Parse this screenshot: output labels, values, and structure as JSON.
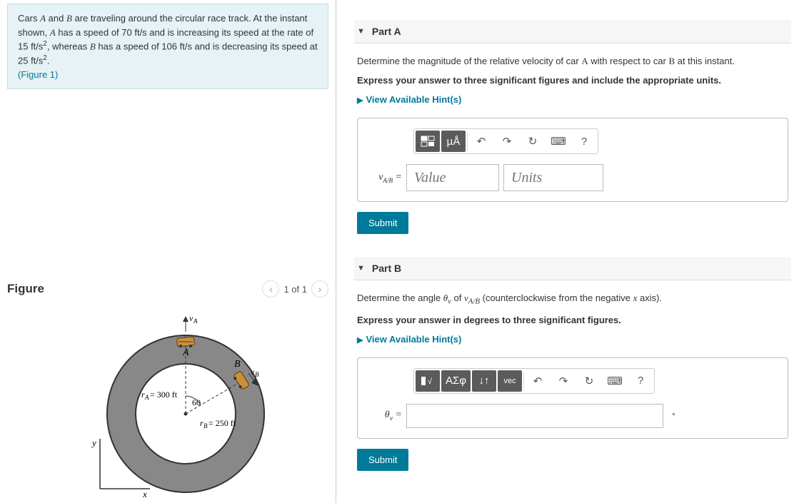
{
  "problem": {
    "text_parts": {
      "p1": "Cars ",
      "A": "A",
      "p2": " and ",
      "B": "B",
      "p3": " are traveling around the circular race track. At the instant shown, ",
      "p4": " has a speed of 70 ft/s and is increasing its speed at the rate of 15 ft/s",
      "sq1": "2",
      "p5": ", whereas ",
      "p6": " has a speed of 106 ft/s and is decreasing its speed at 25 ft/s",
      "sq2": "2",
      "p7": "."
    },
    "figlink": "(Figure 1)"
  },
  "figure": {
    "heading": "Figure",
    "page": "1 of 1",
    "labels": {
      "vA": "vA",
      "A": "A",
      "B": "B",
      "vB": "vB",
      "rA": "rA = 300 ft",
      "angle": "60",
      "rB": "rB = 250 ft",
      "y": "y",
      "x": "x"
    }
  },
  "partA": {
    "title": "Part A",
    "instr1": "Determine the magnitude of the relative velocity of car A with respect to car B at this instant.",
    "instr2": "Express your answer to three significant figures and include the appropriate units.",
    "hint": "View Available Hint(s)",
    "eqlabel": "vA/B =",
    "value_ph": "Value",
    "units_ph": "Units",
    "submit": "Submit",
    "toolbar": {
      "units": "µÅ",
      "q": "?"
    }
  },
  "partB": {
    "title": "Part B",
    "instr1": "Determine the angle θv of vA/B (counterclockwise from the negative x axis).",
    "instr2": "Express your answer in degrees to three significant figures.",
    "hint": "View Available Hint(s)",
    "eqlabel": "θv =",
    "submit": "Submit",
    "toolbar": {
      "greek": "ΑΣφ",
      "vec": "vec",
      "q": "?"
    }
  }
}
